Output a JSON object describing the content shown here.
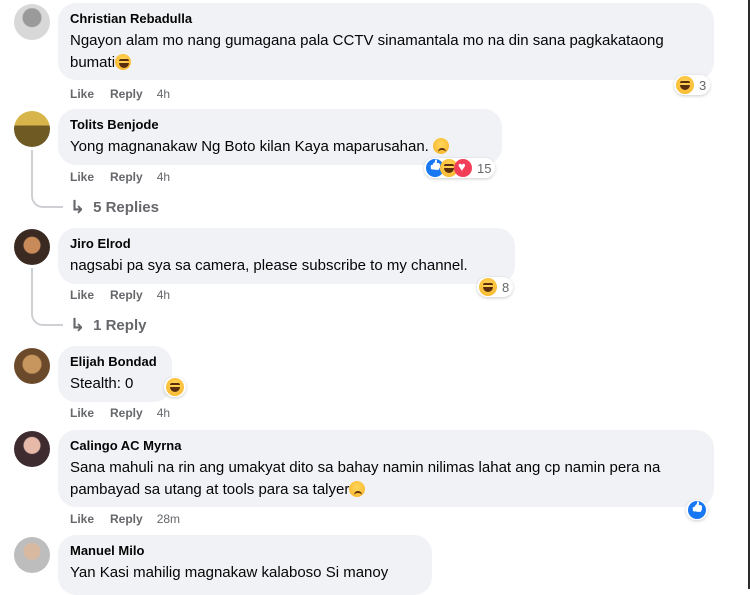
{
  "comments": [
    {
      "name": "Christian Rebadulla",
      "text": "Ngayon alam mo nang gumagana pala CCTV sinamantala mo na din sana pagkakataong bumati",
      "like": "Like",
      "reply": "Reply",
      "time": "4h",
      "reaction_count": "3"
    },
    {
      "name": "Tolits Benjode",
      "text": "Yong magnanakaw Ng Boto kilan Kaya maparusahan.",
      "like": "Like",
      "reply": "Reply",
      "time": "4h",
      "reaction_count": "15",
      "replies": "5 Replies"
    },
    {
      "name": "Jiro Elrod",
      "text": "nagsabi pa sya sa camera, please subscribe to my channel.",
      "like": "Like",
      "reply": "Reply",
      "time": "4h",
      "reaction_count": "8",
      "replies": "1 Reply"
    },
    {
      "name": "Elijah Bondad",
      "text": "Stealth: 0",
      "like": "Like",
      "reply": "Reply",
      "time": "4h"
    },
    {
      "name": "Calingo AC Myrna",
      "text": "Sana mahuli na rin ang umakyat dito sa bahay namin nilimas lahat ang cp namin pera na pambayad sa utang at tools para sa talyer",
      "like": "Like",
      "reply": "Reply",
      "time": "28m"
    },
    {
      "name": "Manuel Milo",
      "text": "Yan Kasi mahilig magnakaw kalaboso Si manoy"
    }
  ],
  "colors": {
    "bubble": "#f0f2f5",
    "meta": "#65676b",
    "like_blue": "#1877f2",
    "love_red": "#f33e58"
  }
}
